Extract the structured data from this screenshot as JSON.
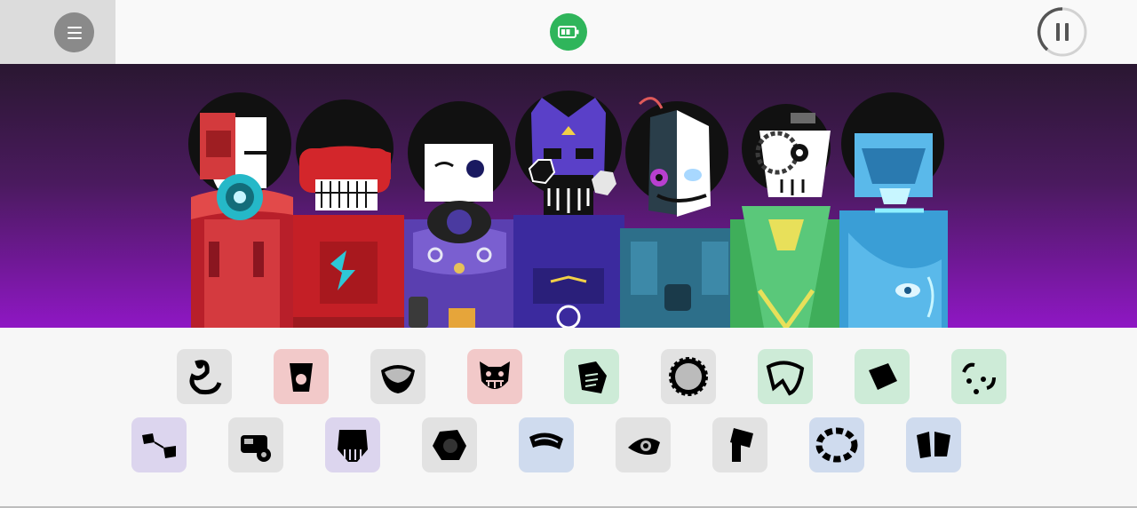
{
  "topbar": {
    "menu_icon": "hamburger-menu-icon",
    "battery_icon": "battery-icon",
    "pause_icon": "pause-icon",
    "colors": {
      "menu_bg": "#dcdcdc",
      "menu_button": "#8a8a8a",
      "battery": "#2fb55b",
      "pause_ring": "#555555"
    }
  },
  "stage": {
    "background_top": "#2a1731",
    "background_bottom": "#8f17c4",
    "characters": [
      {
        "color": "#c8262b",
        "accent": "#2ec7d6"
      },
      {
        "color": "#d3262b",
        "accent": "#2ec7d6"
      },
      {
        "color": "#5a3fb0",
        "accent": "#e6c15a"
      },
      {
        "color": "#3b2a9e",
        "accent": "#f2d047"
      },
      {
        "color": "#2d6f8a",
        "accent": "#b83fd0"
      },
      {
        "color": "#3fae5a",
        "accent": "#e8e05a"
      },
      {
        "color": "#3a9ed6",
        "accent": "#8ff0ff"
      }
    ]
  },
  "tray": {
    "row1": [
      {
        "icon": "swirl-sound-icon",
        "tile": "#e2e2e2"
      },
      {
        "icon": "cup-sound-icon",
        "tile": "#f2c9c9"
      },
      {
        "icon": "bowl-sound-icon",
        "tile": "#e2e2e2"
      },
      {
        "icon": "monster-face-sound-icon",
        "tile": "#f2c9c9"
      },
      {
        "icon": "card-sound-icon",
        "tile": "#cdebd7"
      },
      {
        "icon": "gear-sound-icon",
        "tile": "#e2e2e2"
      },
      {
        "icon": "leaf-sound-icon",
        "tile": "#cdebd7"
      },
      {
        "icon": "square-sound-icon",
        "tile": "#cdebd7"
      },
      {
        "icon": "dots-sound-icon",
        "tile": "#cdebd7"
      }
    ],
    "row2": [
      {
        "icon": "feet-sound-icon",
        "tile": "#dcd5ee"
      },
      {
        "icon": "machine-sound-icon",
        "tile": "#e2e2e2"
      },
      {
        "icon": "claw-sound-icon",
        "tile": "#dcd5ee"
      },
      {
        "icon": "blob-sound-icon",
        "tile": "#e2e2e2"
      },
      {
        "icon": "arc-sound-icon",
        "tile": "#cfdbee"
      },
      {
        "icon": "eye-sound-icon",
        "tile": "#e2e2e2"
      },
      {
        "icon": "hammer-sound-icon",
        "tile": "#e2e2e2"
      },
      {
        "icon": "ring-sound-icon",
        "tile": "#cfdbee"
      },
      {
        "icon": "shards-sound-icon",
        "tile": "#cfdbee"
      }
    ]
  }
}
